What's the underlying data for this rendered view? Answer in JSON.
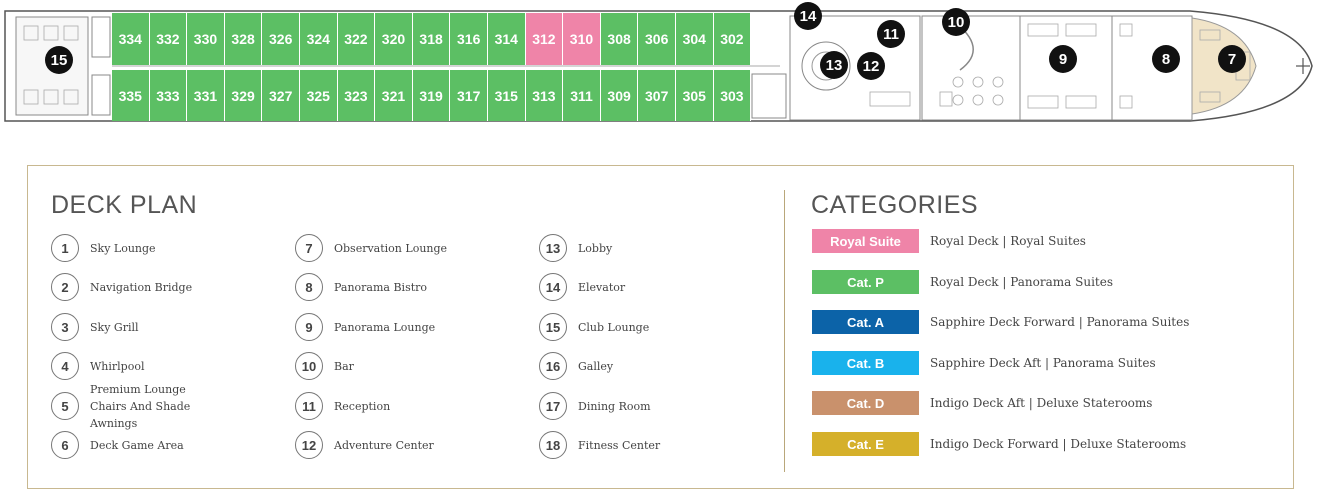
{
  "ship": {
    "cabins_upper": [
      "334",
      "332",
      "330",
      "328",
      "326",
      "324",
      "322",
      "320",
      "318",
      "316",
      "314",
      "312",
      "310",
      "308",
      "306",
      "304",
      "302"
    ],
    "cabins_lower": [
      "335",
      "333",
      "331",
      "329",
      "327",
      "325",
      "323",
      "321",
      "319",
      "317",
      "315",
      "313",
      "311",
      "309",
      "307",
      "305",
      "303"
    ],
    "suite_cabins": [
      "312",
      "310"
    ],
    "markers": [
      "15",
      "14",
      "10",
      "11",
      "13",
      "12",
      "9",
      "8",
      "7"
    ]
  },
  "legend": {
    "deck_plan_title": "DECK PLAN",
    "items": [
      {
        "n": "1",
        "label": "Sky Lounge"
      },
      {
        "n": "2",
        "label": "Navigation Bridge"
      },
      {
        "n": "3",
        "label": "Sky Grill"
      },
      {
        "n": "4",
        "label": "Whirlpool"
      },
      {
        "n": "5",
        "label": "Premium Lounge Chairs And Shade Awnings"
      },
      {
        "n": "6",
        "label": "Deck Game Area"
      },
      {
        "n": "7",
        "label": "Observation Lounge"
      },
      {
        "n": "8",
        "label": "Panorama Bistro"
      },
      {
        "n": "9",
        "label": "Panorama Lounge"
      },
      {
        "n": "10",
        "label": "Bar"
      },
      {
        "n": "11",
        "label": "Reception"
      },
      {
        "n": "12",
        "label": "Adventure Center"
      },
      {
        "n": "13",
        "label": "Lobby"
      },
      {
        "n": "14",
        "label": "Elevator"
      },
      {
        "n": "15",
        "label": "Club Lounge"
      },
      {
        "n": "16",
        "label": "Galley"
      },
      {
        "n": "17",
        "label": "Dining Room"
      },
      {
        "n": "18",
        "label": "Fitness Center"
      }
    ],
    "categories_title": "CATEGORIES",
    "categories": [
      {
        "name": "Royal Suite",
        "desc": "Royal Deck | Royal Suites",
        "color": "#ef84a8"
      },
      {
        "name": "Cat. P",
        "desc": "Royal Deck | Panorama Suites",
        "color": "#5cbf64"
      },
      {
        "name": "Cat. A",
        "desc": "Sapphire Deck Forward | Panorama Suites",
        "color": "#0c63a8"
      },
      {
        "name": "Cat. B",
        "desc": "Sapphire Deck Aft | Panorama Suites",
        "color": "#19b2ec"
      },
      {
        "name": "Cat. D",
        "desc": "Indigo Deck Aft | Deluxe Staterooms",
        "color": "#c9916c"
      },
      {
        "name": "Cat. E",
        "desc": "Indigo Deck Forward | Deluxe Staterooms",
        "color": "#d5b02a"
      }
    ]
  }
}
